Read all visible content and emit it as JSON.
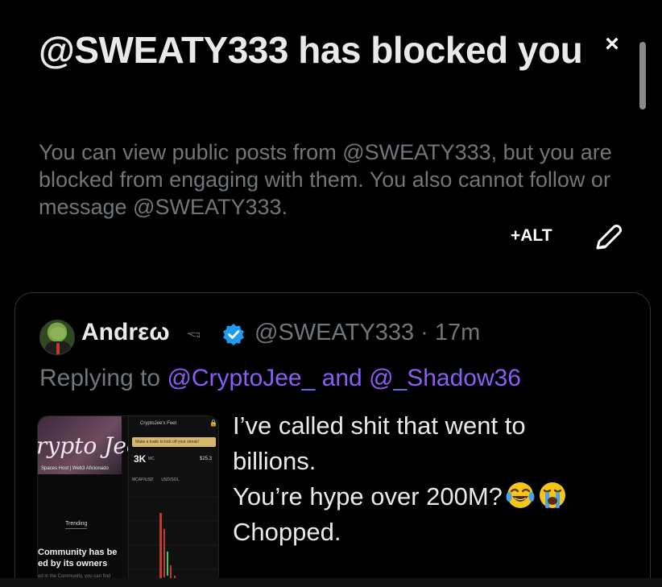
{
  "dialog": {
    "title": "@SWEATY333 has blocked you",
    "subtitle": "You can view public posts from @SWEATY333, but you are blocked from engaging with them. You also cannot follow or message @SWEATY333.",
    "close_icon": "×",
    "alt_label": "+ALT"
  },
  "quoted_post": {
    "display_name": "Andrεω",
    "name_emoji": "🖘",
    "handle_time": "@SWEATY333 · 17m",
    "replying_prefix": "Replying to",
    "replying_mention_1": "@CryptoJee_",
    "replying_and": "and",
    "replying_mention_2": "@_Shadow36",
    "text_lines": [
      "I’ve called shit that went to",
      "billions.",
      "You’re hype over 200M?",
      "Chopped."
    ],
    "thumbnail": {
      "banner_text": "rypto Jee",
      "banner_sub": "Spaces Host | Web3 Aficionado",
      "trending": "Trending",
      "community_line_1": "Community has be",
      "community_line_2": "ed by its owners",
      "community_sub": "ed in the Community, you can find",
      "feed_title": "CryptoJee's Feet",
      "trade_banner": "Make a trade to kick off your streak!",
      "mc_value": "3K",
      "mc_label": "MC",
      "price": "$25.3",
      "tabs": [
        "MCAP/USD",
        "USD/SOL"
      ]
    }
  },
  "colors": {
    "background": "#000000",
    "primary_text": "#e7e9ea",
    "muted_text": "#71767b",
    "mention": "#8b5cf6",
    "verified": "#1d9bf0",
    "card_border": "#2f3336"
  }
}
